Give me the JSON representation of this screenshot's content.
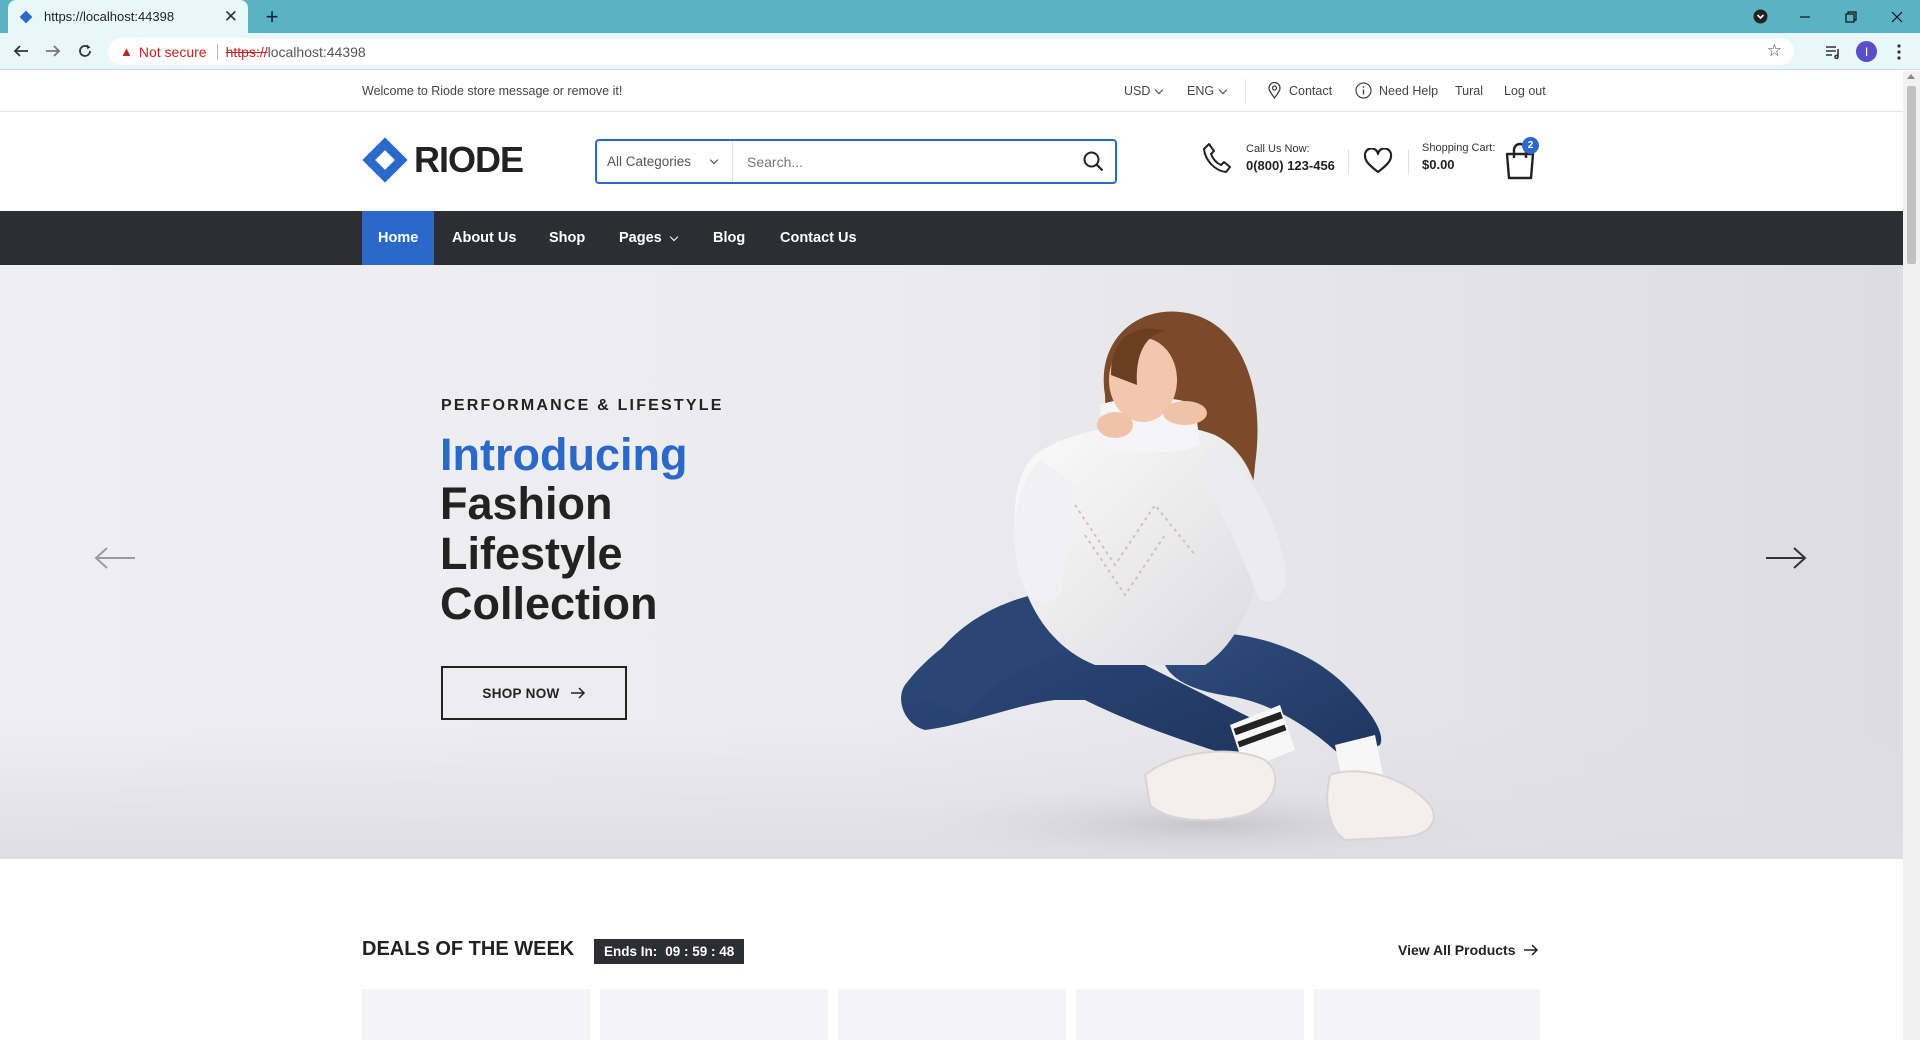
{
  "browser": {
    "tab_title": "https://localhost:44398",
    "security_label": "Not secure",
    "url_scheme": "https://",
    "url_host": "localhost:44398",
    "profile_initial": "I"
  },
  "topbar": {
    "welcome": "Welcome to Riode store message or remove it!",
    "currency": "USD",
    "language": "ENG",
    "contact": "Contact",
    "help": "Need Help",
    "user": "Tural",
    "logout": "Log out"
  },
  "header": {
    "logo": "RIODE",
    "category_select": "All Categories",
    "search_placeholder": "Search...",
    "call_label": "Call Us Now:",
    "phone": "0(800) 123-456",
    "cart_label": "Shopping Cart:",
    "cart_total": "$0.00",
    "cart_count": "2"
  },
  "nav": {
    "items": [
      {
        "label": "Home",
        "active": true
      },
      {
        "label": "About Us"
      },
      {
        "label": "Shop"
      },
      {
        "label": "Pages"
      },
      {
        "label": "Blog"
      },
      {
        "label": "Contact Us"
      }
    ]
  },
  "hero": {
    "subtitle": "PERFORMANCE & LIFESTYLE",
    "intro": "Introducing",
    "line1": "Fashion",
    "line2": "Lifestyle",
    "line3": "Collection",
    "button": "SHOP NOW"
  },
  "deals": {
    "title": "DEALS OF THE WEEK",
    "ends_label": "Ends In:",
    "countdown": "09 : 59 : 48",
    "view_all": "View All Products"
  },
  "colors": {
    "accent": "#2a68c9",
    "nav_bg": "#2d2e32",
    "chrome_teal": "#5ab3c2"
  }
}
